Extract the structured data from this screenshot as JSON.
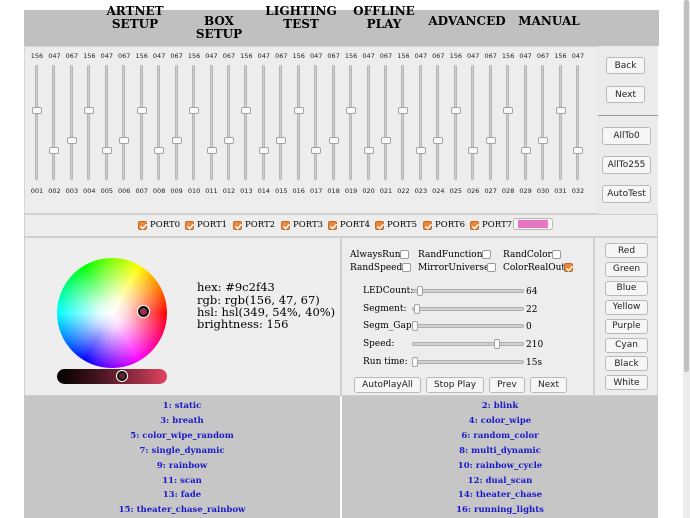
{
  "nav": [
    "ARTNET\nSETUP",
    "BOX SETUP",
    "LIGHTING\nTEST",
    "OFFLINE\nPLAY",
    "ADVANCED",
    "MANUAL"
  ],
  "slider_values": [
    "156",
    "047",
    "067",
    "156",
    "047",
    "067",
    "156",
    "047",
    "067",
    "156",
    "047",
    "067",
    "156",
    "047",
    "067",
    "156",
    "047",
    "067",
    "156",
    "047",
    "067",
    "156",
    "047",
    "067",
    "156",
    "047",
    "067",
    "156",
    "047",
    "067",
    "156",
    "047"
  ],
  "slider_levels": [
    0.61,
    0.23,
    0.33,
    0.61,
    0.23,
    0.33,
    0.61,
    0.23,
    0.33,
    0.61,
    0.23,
    0.33,
    0.61,
    0.23,
    0.33,
    0.61,
    0.23,
    0.33,
    0.61,
    0.23,
    0.33,
    0.61,
    0.23,
    0.33,
    0.61,
    0.23,
    0.33,
    0.61,
    0.23,
    0.33,
    0.61,
    0.23
  ],
  "channels": [
    "001",
    "002",
    "003",
    "004",
    "005",
    "006",
    "007",
    "008",
    "009",
    "010",
    "011",
    "012",
    "013",
    "014",
    "015",
    "016",
    "017",
    "018",
    "019",
    "020",
    "021",
    "022",
    "023",
    "024",
    "025",
    "026",
    "027",
    "028",
    "029",
    "030",
    "031",
    "032"
  ],
  "side_buttons": [
    "Back",
    "Next",
    "AllTo0",
    "AllTo255",
    "AutoTest"
  ],
  "ports": [
    {
      "label": "PORT0",
      "checked": true
    },
    {
      "label": "PORT1",
      "checked": true
    },
    {
      "label": "PORT2",
      "checked": true
    },
    {
      "label": "PORT3",
      "checked": true
    },
    {
      "label": "PORT4",
      "checked": true
    },
    {
      "label": "PORT5",
      "checked": true
    },
    {
      "label": "PORT6",
      "checked": true
    },
    {
      "label": "PORT7",
      "checked": true
    }
  ],
  "color_info": {
    "hex": "hex: #9c2f43",
    "rgb": "rgb: rgb(156, 47, 67)",
    "hsl": "hsl: hsl(349, 54%, 40%)",
    "brightness": "brightness: 156"
  },
  "options": [
    {
      "label": "AlwaysRun",
      "checked": false
    },
    {
      "label": "RandFunction",
      "checked": false
    },
    {
      "label": "RandColor",
      "checked": false
    },
    {
      "label": "RandSpeed",
      "checked": false
    },
    {
      "label": "MirrorUniverse",
      "checked": false
    },
    {
      "label": "ColorRealOut",
      "checked": true
    }
  ],
  "params": [
    {
      "label": "LEDCount:",
      "value": "64",
      "level": 0.05
    },
    {
      "label": "Segment:",
      "value": "22",
      "level": 0.02
    },
    {
      "label": "Segm_Gap:",
      "value": "0",
      "level": 0.0
    },
    {
      "label": "Speed:",
      "value": "210",
      "level": 0.77
    },
    {
      "label": "Run time:",
      "value": "15s",
      "level": 0.0
    }
  ],
  "play_buttons": [
    "AutoPlayAll",
    "Stop Play",
    "Prev",
    "Next"
  ],
  "color_buttons": [
    "Red",
    "Green",
    "Blue",
    "Yellow",
    "Purple",
    "Cyan",
    "Black",
    "White"
  ],
  "effects_left": [
    "1: static",
    "3: breath",
    "5: color_wipe_random",
    "7: single_dynamic",
    "9: rainbow",
    "11: scan",
    "13: fade",
    "15: theater_chase_rainbow"
  ],
  "effects_right": [
    "2: blink",
    "4: color_wipe",
    "6: random_color",
    "8: multi_dynamic",
    "10: rainbow_cycle",
    "12: dual_scan",
    "14: theater_chase",
    "16: running_lights"
  ],
  "colors": {
    "checkbox": "#e8893d",
    "swatch": "#e676c0",
    "effect_text": "#1a1acc",
    "selected_color": "#9c2f43"
  }
}
